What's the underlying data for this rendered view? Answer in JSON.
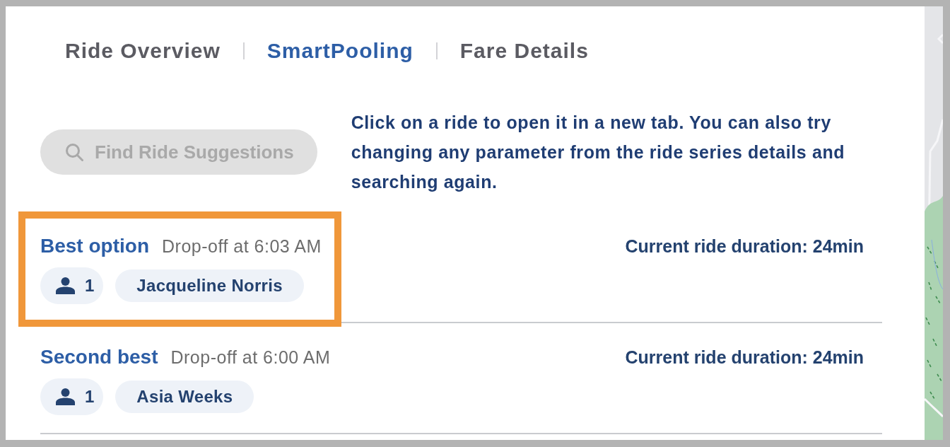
{
  "tabs": [
    {
      "label": "Ride Overview",
      "selected": false
    },
    {
      "label": "SmartPooling",
      "selected": true
    },
    {
      "label": "Fare Details",
      "selected": false
    }
  ],
  "search_button": {
    "label": "Find Ride Suggestions",
    "disabled": true
  },
  "instructions": "Click on a ride to open it in a new tab. You can also try changing any parameter from the ride series details and searching again.",
  "rides": [
    {
      "title": "Best option",
      "dropoff": "Drop-off at 6:03 AM",
      "passengers": "1",
      "rider": "Jacqueline Norris",
      "duration": "Current ride duration: 24min",
      "highlighted": true
    },
    {
      "title": "Second best",
      "dropoff": "Drop-off at 6:00 AM",
      "passengers": "1",
      "rider": "Asia Weeks",
      "duration": "Current ride duration: 24min",
      "highlighted": false
    }
  ]
}
